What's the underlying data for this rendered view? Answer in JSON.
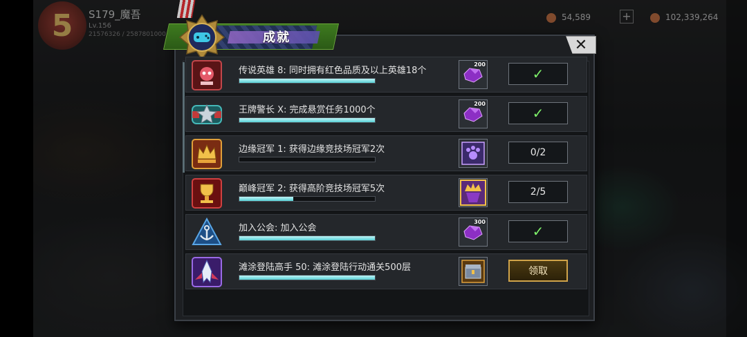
{
  "hud": {
    "player_name": "S179_魔吾",
    "level": "Lv.156",
    "ids": "21576326 / 2587801000",
    "resources": [
      {
        "name": "gold",
        "value": "54,589"
      },
      {
        "name": "silver",
        "value": "102,339,264"
      }
    ]
  },
  "dialog": {
    "title": "成就",
    "close_label": "✕",
    "achievements": [
      {
        "name": "传说英雄 8: 同时拥有红色品质及以上英雄18个",
        "progress": 1.0,
        "reward_icon": "purple-gem-icon",
        "reward_qty": "200",
        "status": "✓"
      },
      {
        "name": "王牌警长 X: 完成悬赏任务1000个",
        "progress": 1.0,
        "reward_icon": "purple-gem-icon",
        "reward_qty": "200",
        "status": "✓"
      },
      {
        "name": "边缘冠军 1: 获得边缘竞技场冠军2次",
        "progress": 0.0,
        "reward_icon": "paw-badge-icon",
        "reward_qty": "",
        "status": "0/2"
      },
      {
        "name": "巅峰冠军 2: 获得高阶竞技场冠军5次",
        "progress": 0.4,
        "reward_icon": "crown-frame-icon",
        "reward_qty": "",
        "status": "2/5"
      },
      {
        "name": "加入公会: 加入公会",
        "progress": 1.0,
        "reward_icon": "purple-gem-icon",
        "reward_qty": "300",
        "status": "✓"
      },
      {
        "name": "滩涂登陆高手 50: 滩涂登陆行动通关500层",
        "progress": 1.0,
        "reward_icon": "supply-chest-icon",
        "reward_qty": "",
        "status": "领取"
      }
    ]
  },
  "colors": {
    "progress_fill": "#58d0d6",
    "check": "#7ef06a",
    "claim_border": "#d1a44a"
  }
}
